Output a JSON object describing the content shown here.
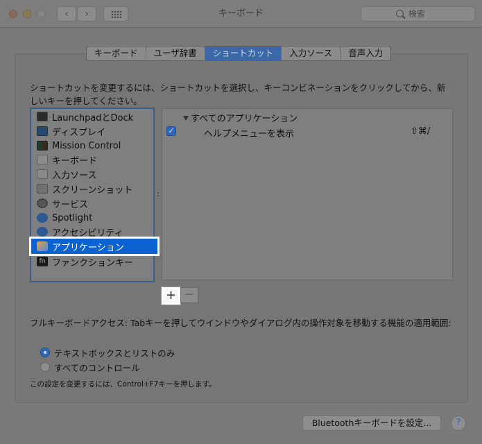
{
  "window": {
    "title": "キーボード"
  },
  "search": {
    "placeholder": "検索"
  },
  "tabs": [
    {
      "label": "キーボード",
      "active": false
    },
    {
      "label": "ユーザ辞書",
      "active": false
    },
    {
      "label": "ショートカット",
      "active": true
    },
    {
      "label": "入力ソース",
      "active": false
    },
    {
      "label": "音声入力",
      "active": false
    }
  ],
  "description": "ショートカットを変更するには、ショートカットを選択し、キーコンビネーションをクリックしてから、新しいキーを押してください。",
  "categories": [
    {
      "label": "LaunchpadとDock",
      "icon": "launchpad-icon"
    },
    {
      "label": "ディスプレイ",
      "icon": "display-icon"
    },
    {
      "label": "Mission Control",
      "icon": "mission-control-icon"
    },
    {
      "label": "キーボード",
      "icon": "keyboard-icon"
    },
    {
      "label": "入力ソース",
      "icon": "input-source-icon"
    },
    {
      "label": "スクリーンショット",
      "icon": "screenshot-icon"
    },
    {
      "label": "サービス",
      "icon": "services-icon"
    },
    {
      "label": "Spotlight",
      "icon": "spotlight-icon"
    },
    {
      "label": "アクセシビリティ",
      "icon": "accessibility-icon"
    },
    {
      "label": "アプリケーション",
      "icon": "app-shortcuts-icon",
      "selected": true
    },
    {
      "label": "ファンクションキー",
      "icon": "function-key-icon"
    }
  ],
  "shortcuts": {
    "group_label": "すべてのアプリケーション",
    "items": [
      {
        "checked": true,
        "label": "ヘルプメニューを表示",
        "keys": "⇧⌘/"
      }
    ]
  },
  "buttons": {
    "plus": "+",
    "minus": "−"
  },
  "full_keyboard_access": {
    "label": "フルキーボードアクセス: Tabキーを押してウインドウやダイアログ内の操作対象を移動する機能の適用範囲:",
    "options": [
      {
        "label": "テキストボックスとリストのみ",
        "selected": true
      },
      {
        "label": "すべてのコントロール",
        "selected": false
      }
    ],
    "note": "この設定を変更するには、Control+F7キーを押します。"
  },
  "footer": {
    "bluetooth_button": "Bluetoothキーボードを設定...",
    "help": "?"
  },
  "colors": {
    "accent": "#0b63d1",
    "tab_active": "#3a68a8"
  }
}
